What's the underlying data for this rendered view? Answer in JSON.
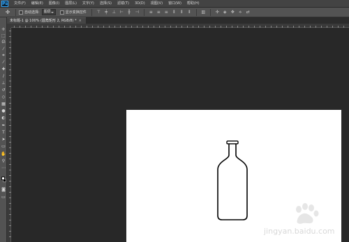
{
  "app": {
    "logo_text": "Ps"
  },
  "menu": {
    "items": [
      "文件(F)",
      "编辑(E)",
      "图像(I)",
      "图层(L)",
      "文字(Y)",
      "选择(S)",
      "滤镜(T)",
      "3D(D)",
      "视图(V)",
      "窗口(W)",
      "帮助(H)"
    ]
  },
  "options": {
    "tool_icon": "move-tool-icon",
    "auto_select_label": "自动选择:",
    "auto_select_value": "图层",
    "show_transform_label": "显示变换控件",
    "align_icons": [
      "align-top-icon",
      "align-vcenter-icon",
      "align-bottom-icon",
      "align-left-icon",
      "align-hcenter-icon",
      "align-right-icon",
      "distribute-top-icon",
      "distribute-vcenter-icon",
      "distribute-bottom-icon",
      "distribute-left-icon",
      "distribute-hcenter-icon",
      "distribute-right-icon",
      "auto-align-icon",
      "3d-mode-icon"
    ]
  },
  "document": {
    "tab_title": "未标题-1 @ 100% (圆角矩形 2, RGB/8) *",
    "close_glyph": "×",
    "canvas_color": "#ffffff"
  },
  "tools": {
    "icons": [
      "move-tool-icon",
      "marquee-tool-icon",
      "lasso-tool-icon",
      "quick-select-tool-icon",
      "crop-tool-icon",
      "eyedropper-tool-icon",
      "healing-brush-tool-icon",
      "brush-tool-icon",
      "clone-stamp-tool-icon",
      "history-brush-tool-icon",
      "eraser-tool-icon",
      "gradient-tool-icon",
      "blur-tool-icon",
      "dodge-tool-icon",
      "pen-tool-icon",
      "type-tool-icon",
      "path-select-tool-icon",
      "shape-tool-icon",
      "hand-tool-icon",
      "zoom-tool-icon",
      "more-tools-icon"
    ],
    "foreground_color": "#ffffff",
    "background_color": "#000000"
  },
  "watermark": {
    "text": "jingyan.baidu.com",
    "logo": "baidu-paw-logo"
  }
}
